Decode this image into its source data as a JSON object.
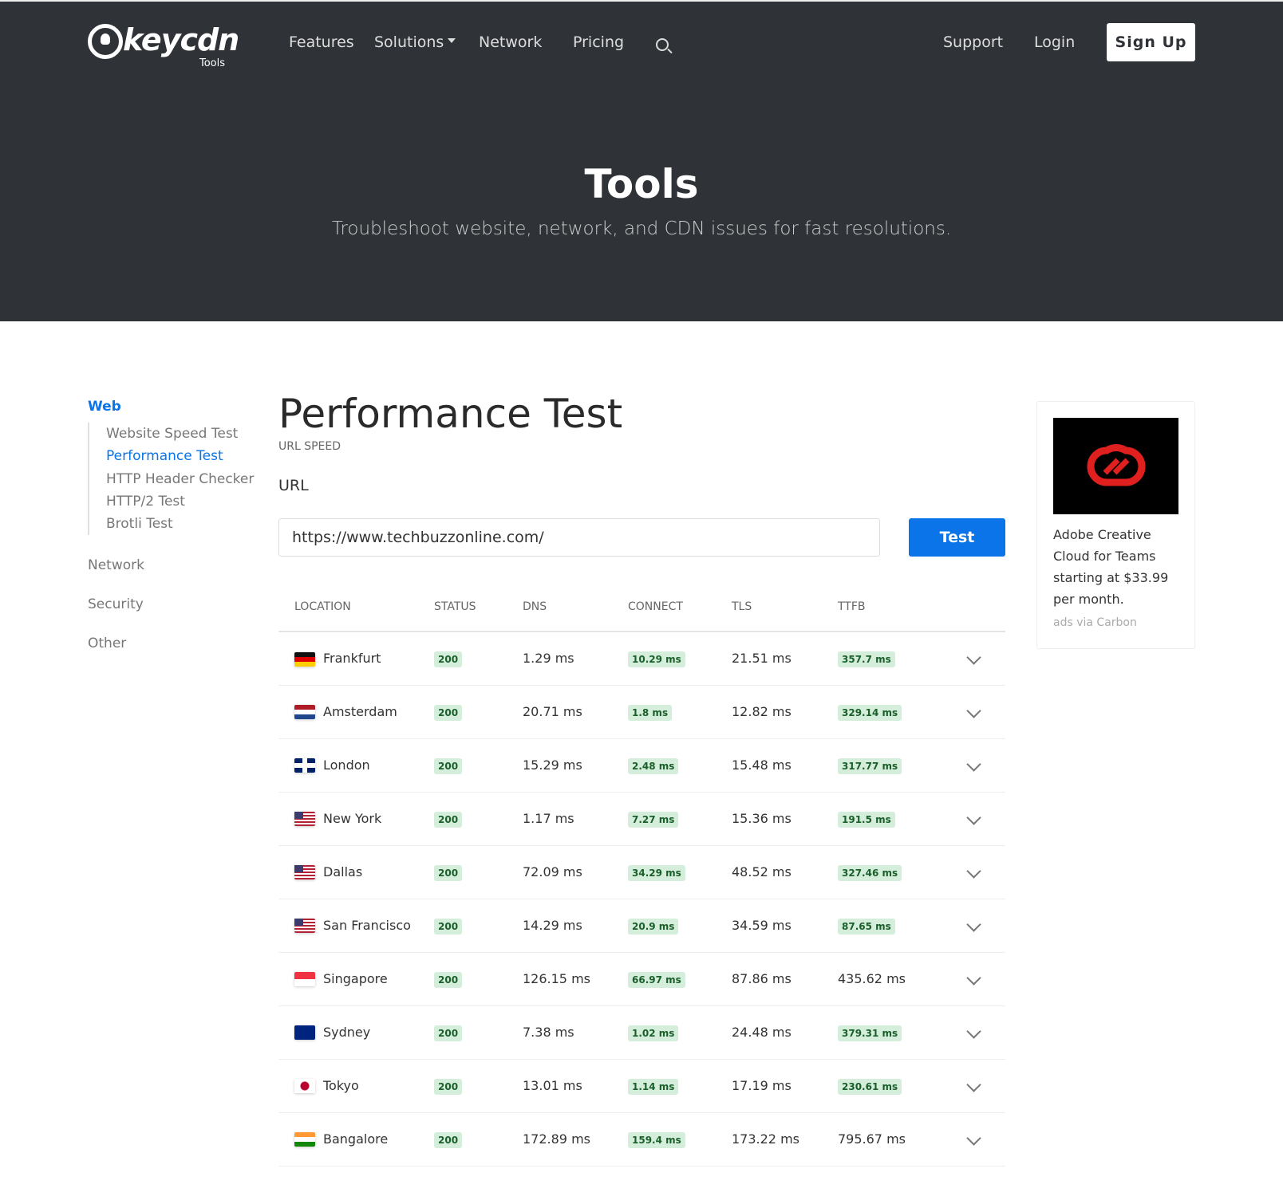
{
  "header": {
    "logo_text": "keycdn",
    "logo_sub": "Tools",
    "nav": [
      "Features",
      "Solutions",
      "Network",
      "Pricing"
    ],
    "support": "Support",
    "login": "Login",
    "signup": "Sign Up"
  },
  "hero": {
    "title": "Tools",
    "subtitle": "Troubleshoot website, network, and CDN issues for fast resolutions."
  },
  "sidebar": {
    "web": "Web",
    "web_items": [
      "Website Speed Test",
      "Performance Test",
      "HTTP Header Checker",
      "HTTP/2 Test",
      "Brotli Test"
    ],
    "categories": [
      "Network",
      "Security",
      "Other"
    ]
  },
  "main": {
    "title": "Performance Test",
    "kicker": "URL SPEED",
    "url_label": "URL",
    "url_value": "https://www.techbuzzonline.com/",
    "test_label": "Test"
  },
  "table": {
    "columns": [
      "LOCATION",
      "STATUS",
      "DNS",
      "CONNECT",
      "TLS",
      "TTFB"
    ],
    "rows": [
      {
        "flag": "de",
        "location": "Frankfurt",
        "status": "200",
        "dns": "1.29 ms",
        "connect": "10.29 ms",
        "tls": "21.51 ms",
        "ttfb": "357.7 ms",
        "ttfb_badge": true
      },
      {
        "flag": "nl",
        "location": "Amsterdam",
        "status": "200",
        "dns": "20.71 ms",
        "connect": "1.8 ms",
        "tls": "12.82 ms",
        "ttfb": "329.14 ms",
        "ttfb_badge": true
      },
      {
        "flag": "uk",
        "location": "London",
        "status": "200",
        "dns": "15.29 ms",
        "connect": "2.48 ms",
        "tls": "15.48 ms",
        "ttfb": "317.77 ms",
        "ttfb_badge": true
      },
      {
        "flag": "us",
        "location": "New York",
        "status": "200",
        "dns": "1.17 ms",
        "connect": "7.27 ms",
        "tls": "15.36 ms",
        "ttfb": "191.5 ms",
        "ttfb_badge": true
      },
      {
        "flag": "us",
        "location": "Dallas",
        "status": "200",
        "dns": "72.09 ms",
        "connect": "34.29 ms",
        "tls": "48.52 ms",
        "ttfb": "327.46 ms",
        "ttfb_badge": true
      },
      {
        "flag": "us",
        "location": "San Francisco",
        "status": "200",
        "dns": "14.29 ms",
        "connect": "20.9 ms",
        "tls": "34.59 ms",
        "ttfb": "87.65 ms",
        "ttfb_badge": true
      },
      {
        "flag": "sg",
        "location": "Singapore",
        "status": "200",
        "dns": "126.15 ms",
        "connect": "66.97 ms",
        "tls": "87.86 ms",
        "ttfb": "435.62 ms",
        "ttfb_badge": false
      },
      {
        "flag": "au",
        "location": "Sydney",
        "status": "200",
        "dns": "7.38 ms",
        "connect": "1.02 ms",
        "tls": "24.48 ms",
        "ttfb": "379.31 ms",
        "ttfb_badge": true
      },
      {
        "flag": "jp",
        "location": "Tokyo",
        "status": "200",
        "dns": "13.01 ms",
        "connect": "1.14 ms",
        "tls": "17.19 ms",
        "ttfb": "230.61 ms",
        "ttfb_badge": true
      },
      {
        "flag": "in",
        "location": "Bangalore",
        "status": "200",
        "dns": "172.89 ms",
        "connect": "159.4 ms",
        "tls": "173.22 ms",
        "ttfb": "795.67 ms",
        "ttfb_badge": false
      }
    ]
  },
  "ad": {
    "text": "Adobe Creative Cloud for Teams starting at $33.99 per month.",
    "by": "ads via Carbon"
  },
  "colors": {
    "header_bg": "#2f3337",
    "accent": "#0a74e8",
    "badge_bg": "#d5eedb",
    "adobe_red": "#e01f1f"
  }
}
